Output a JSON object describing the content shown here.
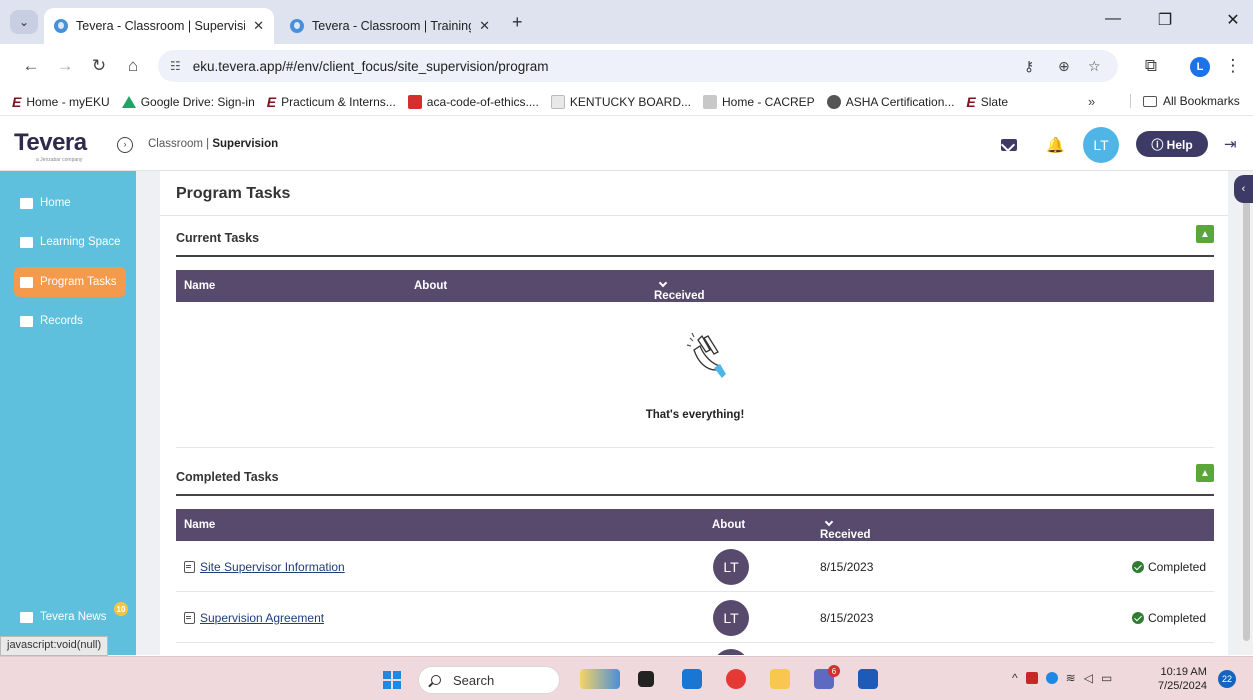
{
  "browser": {
    "tabs": [
      {
        "title": "Tevera - Classroom | Supervision",
        "close": "✕"
      },
      {
        "title": "Tevera - Classroom | Training - (",
        "close": "✕"
      }
    ],
    "new_tab": "+",
    "url": "eku.tevera.app/#/env/client_focus/site_supervision/program",
    "profile_initial": "L",
    "bookmarks": [
      {
        "label": "Home - myEKU",
        "icon": "eku-logo"
      },
      {
        "label": "Google Drive: Sign-in",
        "icon": "google-drive"
      },
      {
        "label": "Practicum & Interns...",
        "icon": "eku-logo"
      },
      {
        "label": "aca-code-of-ethics....",
        "icon": "pdf"
      },
      {
        "label": "KENTUCKY BOARD...",
        "icon": "page"
      },
      {
        "label": "Home - CACREP",
        "icon": "gray-square"
      },
      {
        "label": "ASHA Certification...",
        "icon": "globe"
      },
      {
        "label": "Slate",
        "icon": "eku-logo"
      }
    ],
    "bookmarks_more": "»",
    "all_bookmarks": "All Bookmarks"
  },
  "header": {
    "logo": "Tevera",
    "logo_sub": "a Jenzabar company",
    "context_prefix": "Classroom | ",
    "context_strong": "Supervision",
    "avatar": "LT",
    "help": "ⓘ Help"
  },
  "sidebar": {
    "items": [
      {
        "label": "Home",
        "icon": "grid-icon"
      },
      {
        "label": "Learning Space",
        "icon": "book-icon"
      },
      {
        "label": "Program Tasks",
        "icon": "clipboard-icon",
        "active": true
      },
      {
        "label": "Records",
        "icon": "folder-icon"
      }
    ],
    "news": {
      "label": "Tevera News",
      "badge": "10"
    },
    "status_tip": "javascript:void(null)"
  },
  "main": {
    "title": "Program Tasks",
    "current": {
      "heading": "Current Tasks",
      "columns": {
        "name": "Name",
        "about": "About",
        "received": "Received On"
      },
      "empty_text": "That's everything!"
    },
    "completed": {
      "heading": "Completed Tasks",
      "columns": {
        "name": "Name",
        "about": "About",
        "received": "Received On"
      },
      "rows": [
        {
          "name": "Site Supervisor Information",
          "about": "LT",
          "date": "8/15/2023",
          "status": "Completed"
        },
        {
          "name": "Supervision Agreement",
          "about": "LT",
          "date": "8/15/2023",
          "status": "Completed"
        }
      ]
    }
  },
  "taskbar": {
    "search": "Search",
    "badges": {
      "teams": "6"
    },
    "time": "10:19 AM",
    "date": "7/25/2024",
    "notifications": "22"
  },
  "colors": {
    "sidebar": "#5ec0dd",
    "active_item": "#f39a4c",
    "table_header": "#574a6d",
    "brand_dark": "#3e3a66",
    "collapse": "#5aa63b",
    "completed": "#2e7d32"
  }
}
